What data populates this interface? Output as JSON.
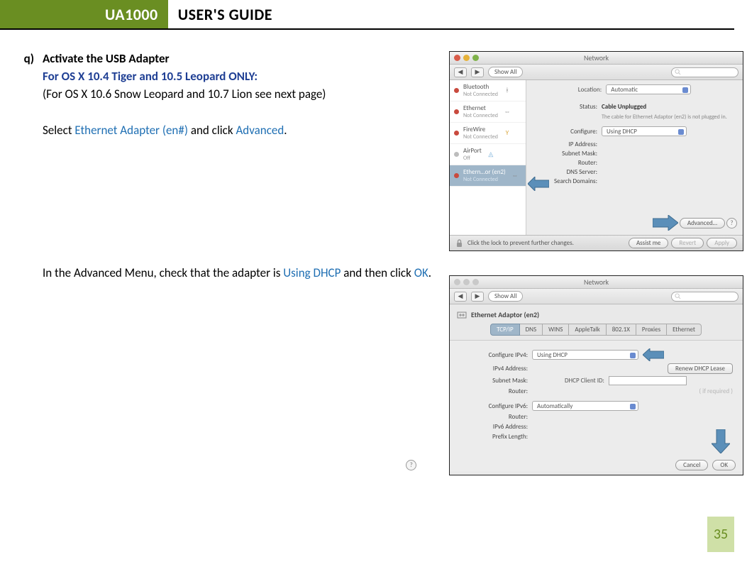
{
  "header": {
    "brand": "UA1000",
    "title": "USER'S GUIDE"
  },
  "step": {
    "marker": "q)",
    "title": "Activate the USB Adapter",
    "os_note": "For OS X 10.4 Tiger and 10.5 Leopard ONLY:",
    "alt_os": "(For OS X 10.6 Snow Leopard and 10.7 Lion see next page)",
    "instr1_prefix": "Select ",
    "instr1_link1": "Ethernet Adapter (en#)",
    "instr1_mid": " and click ",
    "instr1_link2": "Advanced",
    "instr1_suffix": ".",
    "instr2_prefix": "In the Advanced Menu, check that the adapter is ",
    "instr2_link1": "Using DHCP",
    "instr2_mid": " and then click ",
    "instr2_link2": "OK",
    "instr2_suffix": "."
  },
  "shot1": {
    "window_title": "Network",
    "show_all": "Show All",
    "location_label": "Location:",
    "location_value": "Automatic",
    "sidebar": [
      {
        "name": "Bluetooth",
        "sub": "Not Connected",
        "bullet": "#c94a3e",
        "icon": "bluetooth"
      },
      {
        "name": "Ethernet",
        "sub": "Not Connected",
        "bullet": "#c94a3e",
        "icon": "ethernet"
      },
      {
        "name": "FireWire",
        "sub": "Not Connected",
        "bullet": "#c94a3e",
        "icon": "firewire"
      },
      {
        "name": "AirPort",
        "sub": "Off",
        "bullet": "#bdbdbd",
        "icon": "wifi"
      },
      {
        "name": "Ethern…or (en2)",
        "sub": "Not Connected",
        "bullet": "#c94a3e",
        "icon": "ethernet",
        "selected": true
      }
    ],
    "status_label": "Status:",
    "status_value": "Cable Unplugged",
    "status_sub": "The cable for Ethernet Adaptor (en2) is not plugged in.",
    "configure_label": "Configure:",
    "configure_value": "Using DHCP",
    "fields": [
      "IP Address:",
      "Subnet Mask:",
      "Router:",
      "DNS Server:",
      "Search Domains:"
    ],
    "advanced": "Advanced…",
    "lock_text": "Click the lock to prevent further changes.",
    "assist": "Assist me",
    "revert": "Revert",
    "apply": "Apply"
  },
  "shot2": {
    "window_title": "Network",
    "show_all": "Show All",
    "adapter": "Ethernet Adaptor (en2)",
    "tabs": [
      "TCP/IP",
      "DNS",
      "WINS",
      "AppleTalk",
      "802.1X",
      "Proxies",
      "Ethernet"
    ],
    "cfg4_label": "Configure IPv4:",
    "cfg4_value": "Using DHCP",
    "renew": "Renew DHCP Lease",
    "ipv4_addr": "IPv4 Address:",
    "subnet": "Subnet Mask:",
    "dhcp_client": "DHCP Client ID:",
    "if_required": "( if required )",
    "router": "Router:",
    "cfg6_label": "Configure IPv6:",
    "cfg6_value": "Automatically",
    "router6": "Router:",
    "ipv6_addr": "IPv6 Address:",
    "prefix": "Prefix Length:",
    "cancel": "Cancel",
    "ok": "OK"
  },
  "page_number": "35"
}
